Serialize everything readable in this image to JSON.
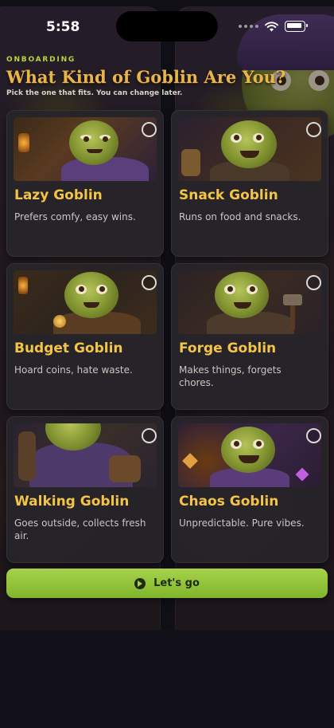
{
  "status_bar": {
    "time": "5:58",
    "icons": [
      "dots-icon",
      "wifi-icon",
      "battery-icon"
    ]
  },
  "header": {
    "eyebrow": "ONBOARDING",
    "title": "What Kind of Goblin Are You?",
    "subtitle": "Pick the one that fits. You can change later."
  },
  "cards": [
    {
      "id": "lazy",
      "title": "Lazy Goblin",
      "description": "Prefers comfy, easy wins.",
      "selected": false
    },
    {
      "id": "snack",
      "title": "Snack Goblin",
      "description": "Runs on food and snacks.",
      "selected": false
    },
    {
      "id": "budget",
      "title": "Budget Goblin",
      "description": "Hoard coins, hate waste.",
      "selected": false
    },
    {
      "id": "forge",
      "title": "Forge Goblin",
      "description": "Makes things, forgets chores.",
      "selected": false
    },
    {
      "id": "walking",
      "title": "Walking Goblin",
      "description": "Goes outside, collects fresh air.",
      "selected": false
    },
    {
      "id": "chaos",
      "title": "Chaos Goblin",
      "description": "Unpredictable. Pure vibes.",
      "selected": false
    }
  ],
  "cta": {
    "label": "Let's go",
    "icon": "arrow-circle-icon"
  },
  "colors": {
    "accent_green": "#a6d24a",
    "title_gold": "#f3c447",
    "eyebrow_green": "#b7d53a",
    "card_bg": "#262429"
  }
}
